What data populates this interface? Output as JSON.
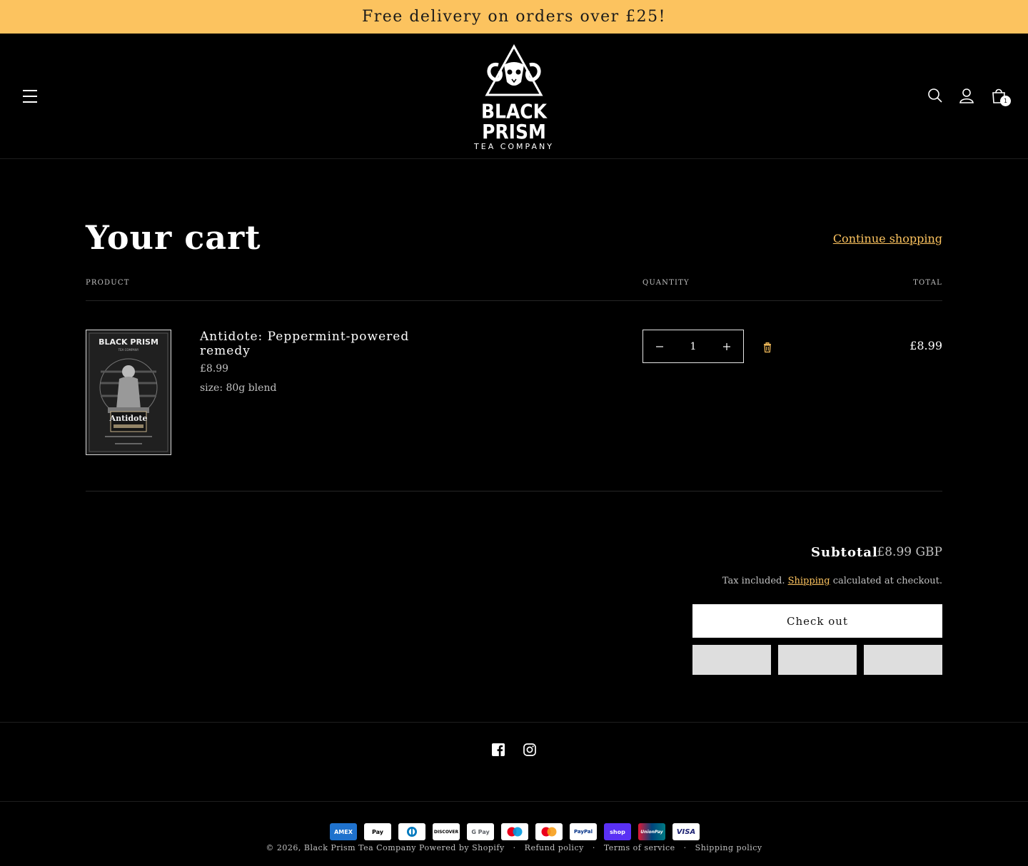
{
  "announcement": "Free delivery on orders over £25!",
  "brand": {
    "name": "BLACK PRISM",
    "tagline": "TEA COMPANY"
  },
  "cart": {
    "title": "Your cart",
    "continue_label": "Continue shopping",
    "count": "1",
    "columns": {
      "product": "PRODUCT",
      "quantity": "QUANTITY",
      "total": "TOTAL"
    },
    "items": [
      {
        "name": "Antidote: Peppermint-powered remedy",
        "price": "£8.99",
        "variant": "size: 80g blend",
        "quantity": "1",
        "total": "£8.99",
        "image_label": "Antidote",
        "image_brand": "BLACK PRISM"
      }
    ],
    "subtotal_label": "Subtotal",
    "subtotal_value": "£8.99 GBP",
    "tax_prefix": "Tax included.",
    "tax_link": "Shipping",
    "tax_suffix": "calculated at checkout.",
    "checkout_label": "Check out"
  },
  "footer": {
    "copyright": "© 2026, Black Prism Tea Company Powered by Shopify",
    "links": [
      "Refund policy",
      "Terms of service",
      "Shipping policy"
    ],
    "payments": [
      "AMEX",
      "Pay",
      "",
      "DISCOVER",
      "G Pay",
      "",
      "",
      "PayPal",
      "shop",
      "UnionPay",
      "VISA"
    ]
  },
  "colors": {
    "accent": "#fcc35f",
    "background": "#000000"
  }
}
